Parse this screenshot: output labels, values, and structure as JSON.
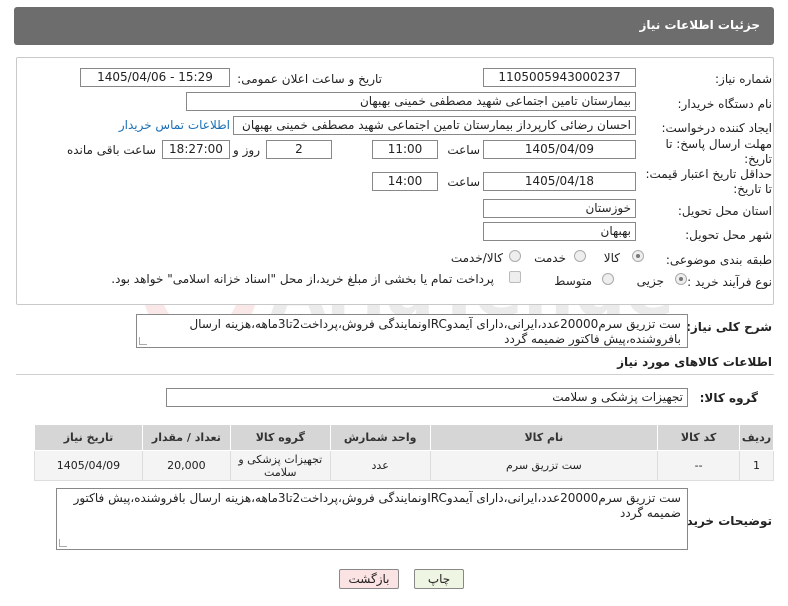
{
  "header": {
    "title": "جزئیات اطلاعات نیاز"
  },
  "fields": {
    "need_number_label": "شماره نیاز:",
    "need_number": "1105005943000237",
    "announce_label": "تاریخ و ساعت اعلان عمومی:",
    "announce_value": "1405/04/06 - 15:29",
    "buyer_org_label": "نام دستگاه خریدار:",
    "buyer_org": "بیمارستان تامین اجتماعی شهید مصطفی خمینی بهبهان",
    "creator_label": "ایجاد کننده درخواست:",
    "creator": "احسان رضائی کارپرداز بیمارستان تامین اجتماعی شهید مصطفی خمینی بهبهان",
    "contact_link": "اطلاعات تماس خریدار",
    "deadline_label_1": "مهلت ارسال پاسخ: تا",
    "deadline_label_2": "تاریخ:",
    "deadline_date": "1405/04/09",
    "time_label": "ساعت",
    "deadline_time": "11:00",
    "days_value": "2",
    "days_label": "روز و",
    "remaining_time": "18:27:00",
    "remaining_label": "ساعت باقی مانده",
    "validity_label_1": "حداقل تاریخ اعتبار قیمت:",
    "validity_label_2": "تا تاریخ:",
    "validity_date": "1405/04/18",
    "validity_time": "14:00",
    "province_label": "استان محل تحویل:",
    "province": "خوزستان",
    "city_label": "شهر محل تحویل:",
    "city": "بهبهان",
    "category_label": "طبقه بندی موضوعی:",
    "category_options": [
      "کالا",
      "خدمت",
      "کالا/خدمت"
    ],
    "process_label": "نوع فرآیند خرید :",
    "process_options": [
      "جزیی",
      "متوسط"
    ],
    "payment_note": "پرداخت تمام یا بخشی از مبلغ خرید،از محل \"اسناد خزانه اسلامی\" خواهد بود."
  },
  "description": {
    "label": "شرح کلی نیاز:",
    "text": "ست تزریق سرم20000عدد،ایرانی،دارای آیمدوIRCونمایندگی فروش،پرداخت2تا3ماهه،هزینه ارسال بافروشنده،پیش فاکتور ضمیمه گردد"
  },
  "goods_info": {
    "title": "اطلاعات کالاهای مورد نیاز",
    "group_label": "گروه کالا:",
    "group_value": "تجهیزات پزشکی و سلامت"
  },
  "table": {
    "headers": [
      "ردیف",
      "کد کالا",
      "نام کالا",
      "واحد شمارش",
      "گروه کالا",
      "تعداد / مقدار",
      "تاریخ نیاز"
    ],
    "rows": [
      [
        "1",
        "--",
        "ست تزریق سرم",
        "عدد",
        "تجهیزات پزشکی و سلامت",
        "20,000",
        "1405/04/09"
      ]
    ]
  },
  "buyer_notes": {
    "label": "توضیحات خریدار:",
    "text": "ست تزریق سرم20000عدد،ایرانی،دارای آیمدوIRCونمایندگی فروش،پرداخت2تا3ماهه،هزینه ارسال بافروشنده،پیش فاکتور ضمیمه گردد"
  },
  "buttons": {
    "print": "چاپ",
    "back": "بازگشت"
  },
  "colors": {
    "header": "#6d6d6d",
    "print_button": "#eef6e3",
    "back_button": "#fbe3e3",
    "link": "#1a6fb5"
  }
}
